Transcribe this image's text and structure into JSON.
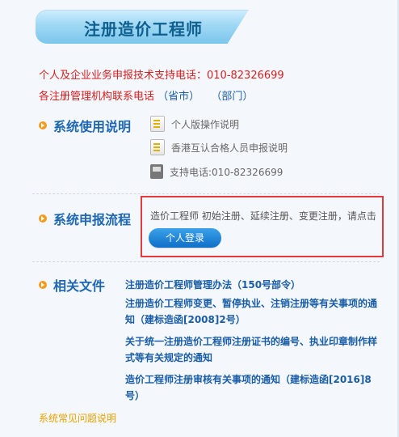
{
  "header": {
    "title": "注册造价工程师"
  },
  "contacts": {
    "line1": "个人及企业业务申报技术支持电话：010-82326699",
    "line2_prefix": "各注册管理机构联系电话",
    "line2_province": "（省市）",
    "line2_dept": "（部门）"
  },
  "usage": {
    "title": "系统使用说明",
    "items": [
      {
        "label": "个人版操作说明",
        "icon": "document-icon"
      },
      {
        "label": "香港互认合格人员申报说明",
        "icon": "document-icon"
      },
      {
        "label": "支持电话:010-82326699",
        "icon": "phone-icon"
      }
    ]
  },
  "flow": {
    "title": "系统申报流程",
    "text": "造价工程师 初始注册、延续注册、变更注册，请点击",
    "login_label": "个人登录"
  },
  "files": {
    "title": "相关文件",
    "items": [
      "注册造价工程师管理办法（150号部令）",
      "注册造价工程师变更、暂停执业、注销注册等有关事项的通知（建标造函[2008]2号）",
      "关于统一注册造价工程师注册证书的编号、执业印章制作样式等有关规定的通知",
      "造价工程师注册审核有关事项的通知（建标造函[2016]8号）"
    ]
  },
  "footer": {
    "faq_label": "系统常见问题说明"
  },
  "colors": {
    "accent_blue": "#1f67b3",
    "red": "#d61f1f",
    "orange": "#f39b1b",
    "highlight_border": "#e33b3b"
  }
}
